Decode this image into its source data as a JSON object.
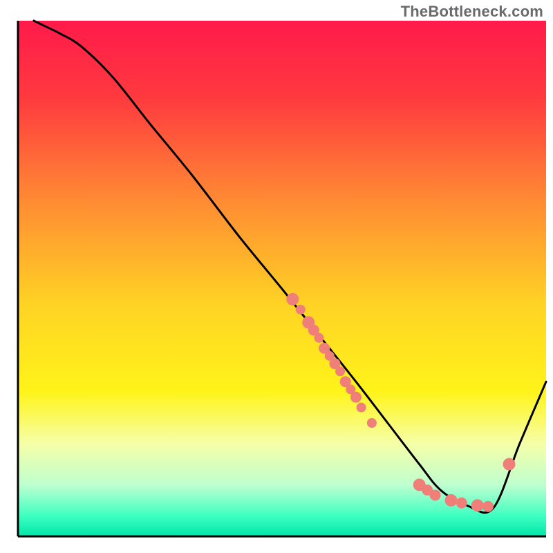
{
  "watermark": "TheBottleneck.com",
  "chart_data": {
    "type": "line",
    "title": "",
    "xlabel": "",
    "ylabel": "",
    "xlim": [
      0,
      100
    ],
    "ylim": [
      0,
      100
    ],
    "background_gradient": {
      "stops": [
        {
          "offset": 0.0,
          "color": "#ff1a4a"
        },
        {
          "offset": 0.15,
          "color": "#ff3a3f"
        },
        {
          "offset": 0.35,
          "color": "#ff8b33"
        },
        {
          "offset": 0.55,
          "color": "#ffd324"
        },
        {
          "offset": 0.72,
          "color": "#fff41a"
        },
        {
          "offset": 0.82,
          "color": "#f6ffa8"
        },
        {
          "offset": 0.9,
          "color": "#bfffcf"
        },
        {
          "offset": 0.96,
          "color": "#3fffc2"
        },
        {
          "offset": 1.0,
          "color": "#00e6a8"
        }
      ]
    },
    "series": [
      {
        "name": "bottleneck-curve",
        "x": [
          3,
          5,
          8,
          12,
          18,
          25,
          33,
          42,
          50,
          57,
          64,
          70,
          76,
          80,
          85,
          90,
          95,
          100
        ],
        "y": [
          100,
          99,
          97.5,
          95,
          89,
          80,
          70,
          58,
          48,
          39,
          30,
          22,
          14,
          9,
          6,
          5.5,
          18,
          30
        ]
      }
    ],
    "scatter": {
      "name": "highlighted-points",
      "color": "#ef7f78",
      "points": [
        {
          "x": 52,
          "y": 46,
          "r": 9
        },
        {
          "x": 53.5,
          "y": 44,
          "r": 7
        },
        {
          "x": 55,
          "y": 41.5,
          "r": 9
        },
        {
          "x": 56,
          "y": 40,
          "r": 8
        },
        {
          "x": 57,
          "y": 38.5,
          "r": 7
        },
        {
          "x": 58,
          "y": 36.5,
          "r": 8
        },
        {
          "x": 59,
          "y": 35,
          "r": 7
        },
        {
          "x": 60,
          "y": 33.5,
          "r": 8
        },
        {
          "x": 61,
          "y": 32,
          "r": 7
        },
        {
          "x": 62,
          "y": 30,
          "r": 8
        },
        {
          "x": 63,
          "y": 28.5,
          "r": 7
        },
        {
          "x": 64,
          "y": 27,
          "r": 8
        },
        {
          "x": 65,
          "y": 25,
          "r": 7
        },
        {
          "x": 67,
          "y": 22,
          "r": 7
        },
        {
          "x": 76,
          "y": 10,
          "r": 9
        },
        {
          "x": 77.5,
          "y": 9,
          "r": 8
        },
        {
          "x": 79,
          "y": 8,
          "r": 8
        },
        {
          "x": 82,
          "y": 7,
          "r": 9
        },
        {
          "x": 84,
          "y": 6.5,
          "r": 8
        },
        {
          "x": 87,
          "y": 6,
          "r": 9
        },
        {
          "x": 89,
          "y": 5.8,
          "r": 8
        },
        {
          "x": 93,
          "y": 14,
          "r": 9
        }
      ]
    }
  }
}
